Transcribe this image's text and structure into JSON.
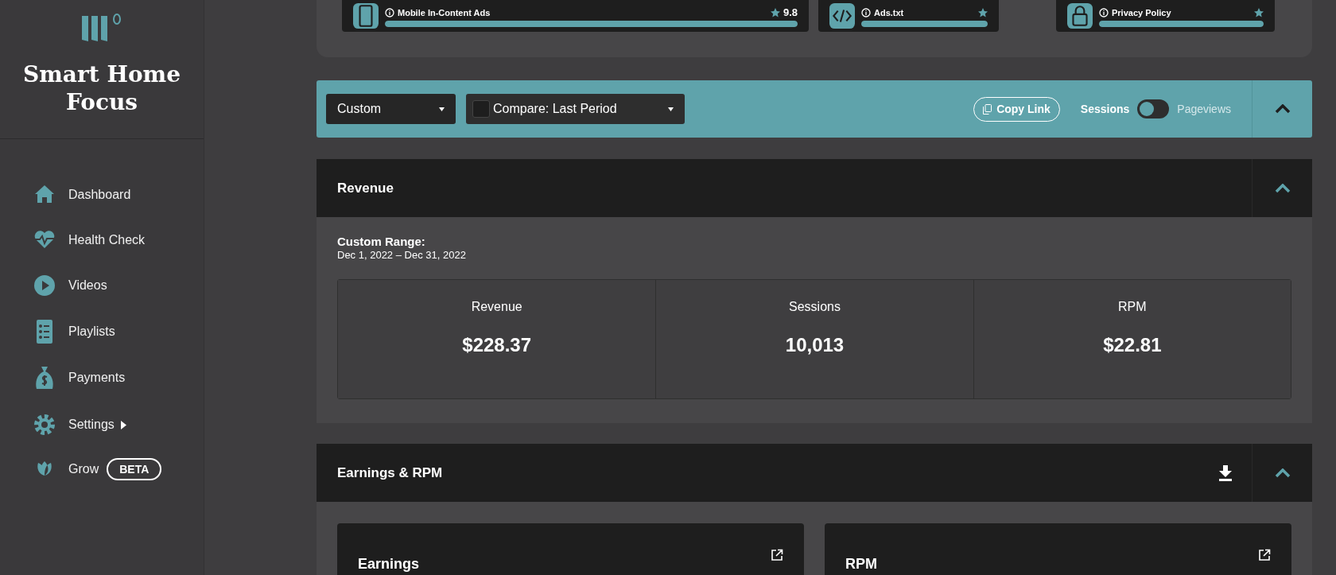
{
  "sidebar": {
    "brand": "Smart Home Focus",
    "nav": [
      {
        "label": "Dashboard",
        "has_submenu": false
      },
      {
        "label": "Health Check",
        "has_submenu": false
      },
      {
        "label": "Videos",
        "has_submenu": false
      },
      {
        "label": "Playlists",
        "has_submenu": false
      },
      {
        "label": "Payments",
        "has_submenu": false
      },
      {
        "label": "Settings",
        "has_submenu": true
      },
      {
        "label": "Grow",
        "has_submenu": false,
        "badge": "BETA"
      }
    ]
  },
  "top_cards": [
    {
      "title": "Mobile In-Content Ads",
      "score": "9.8",
      "level": 1
    },
    {
      "title": "Ads.txt",
      "level": 1
    },
    {
      "title": "Privacy Policy",
      "level": 1
    }
  ],
  "toolbar": {
    "date_range": "Custom",
    "compare": {
      "label": "Compare: Last Period",
      "checked": false
    },
    "copy_link": "Copy Link",
    "metric_options": [
      {
        "label": "Sessions",
        "selected": true
      },
      {
        "label": "Pageviews",
        "selected": false
      }
    ],
    "expanded": true
  },
  "revenue_panel": {
    "title": "Revenue",
    "expanded": true,
    "range_label": "Custom Range:",
    "range": "Dec 1, 2022 – Dec 31, 2022",
    "stats": [
      {
        "label": "Revenue",
        "value": "$228.37"
      },
      {
        "label": "Sessions",
        "value": "10,013"
      },
      {
        "label": "RPM",
        "value": "$22.81"
      }
    ]
  },
  "earnings_panel": {
    "title": "Earnings & RPM",
    "expanded": true,
    "cards": [
      {
        "title": "Earnings"
      },
      {
        "title": "RPM"
      }
    ]
  }
}
